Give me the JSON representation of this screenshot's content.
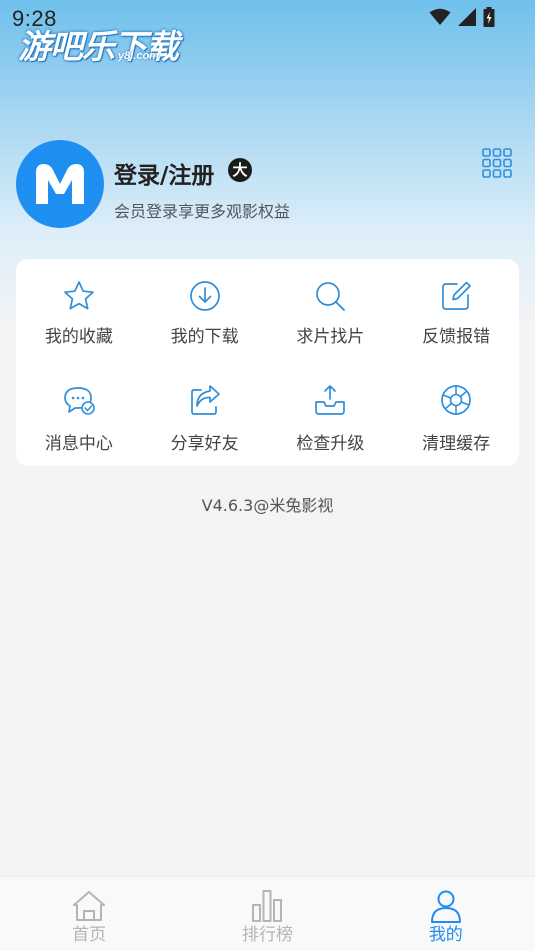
{
  "status_bar": {
    "time": "9:28",
    "icons": [
      "wifi-icon",
      "signal-icon",
      "battery-icon"
    ]
  },
  "watermark": {
    "title": "游吧乐下载",
    "subtitle": "y8l.com"
  },
  "profile": {
    "title": "登录/注册",
    "badge": "大",
    "subtitle": "会员登录享更多观影权益",
    "avatar_letter": "M"
  },
  "functions": [
    {
      "label": "我的收藏",
      "icon": "star-icon"
    },
    {
      "label": "我的下载",
      "icon": "download-icon"
    },
    {
      "label": "求片找片",
      "icon": "search-icon"
    },
    {
      "label": "反馈报错",
      "icon": "edit-icon"
    },
    {
      "label": "消息中心",
      "icon": "message-icon"
    },
    {
      "label": "分享好友",
      "icon": "share-icon"
    },
    {
      "label": "检查升级",
      "icon": "upload-icon"
    },
    {
      "label": "清理缓存",
      "icon": "clean-icon"
    }
  ],
  "version": "V4.6.3@米兔影视",
  "bottom_nav": [
    {
      "label": "首页",
      "icon": "home-icon",
      "active": false
    },
    {
      "label": "排行榜",
      "icon": "ranking-icon",
      "active": false
    },
    {
      "label": "我的",
      "icon": "profile-icon",
      "active": true
    }
  ],
  "colors": {
    "accent": "#1f8ef1",
    "icon_blue": "#2f8fd8",
    "header_top": "#6fc0ec",
    "background": "#f4f4f6"
  }
}
